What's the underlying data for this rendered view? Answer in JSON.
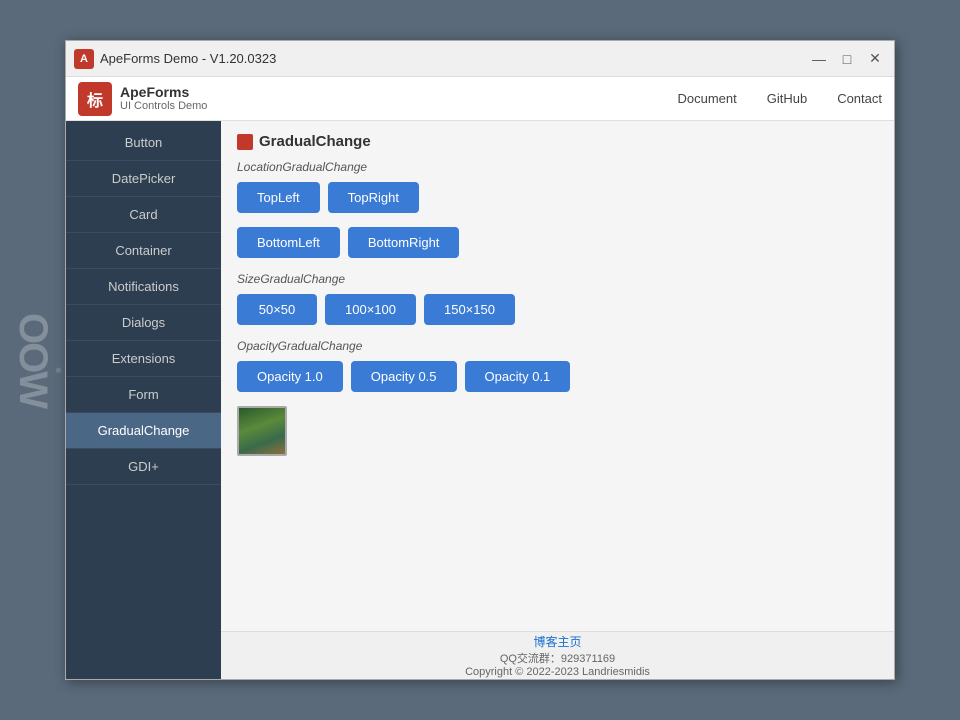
{
  "window": {
    "title": "ApeForms Demo - V1.20.0323",
    "controls": {
      "minimize": "—",
      "maximize": "□",
      "close": "✕"
    }
  },
  "header": {
    "logo_icon": "标",
    "logo_title": "ApeForms",
    "logo_subtitle": "UI Controls Demo",
    "nav": [
      {
        "id": "document",
        "label": "Document"
      },
      {
        "id": "github",
        "label": "GitHub"
      },
      {
        "id": "contact",
        "label": "Contact"
      }
    ]
  },
  "sidebar": {
    "items": [
      {
        "id": "button",
        "label": "Button",
        "active": false
      },
      {
        "id": "datepicker",
        "label": "DatePicker",
        "active": false
      },
      {
        "id": "card",
        "label": "Card",
        "active": false
      },
      {
        "id": "container",
        "label": "Container",
        "active": false
      },
      {
        "id": "notifications",
        "label": "Notifications",
        "active": false
      },
      {
        "id": "dialogs",
        "label": "Dialogs",
        "active": false
      },
      {
        "id": "extensions",
        "label": "Extensions",
        "active": false
      },
      {
        "id": "form",
        "label": "Form",
        "active": false
      },
      {
        "id": "gradualchange",
        "label": "GradualChange",
        "active": true
      },
      {
        "id": "gdiplus",
        "label": "GDI+",
        "active": false
      }
    ]
  },
  "content": {
    "section_icon_color": "#c0392b",
    "section_title": "GradualChange",
    "location_label": "LocationGradualChange",
    "location_buttons": [
      {
        "id": "topleft",
        "label": "TopLeft"
      },
      {
        "id": "topright",
        "label": "TopRight"
      },
      {
        "id": "bottomleft",
        "label": "BottomLeft"
      },
      {
        "id": "bottomright",
        "label": "BottomRight"
      }
    ],
    "size_label": "SizeGradualChange",
    "size_buttons": [
      {
        "id": "size50",
        "label": "50×50"
      },
      {
        "id": "size100",
        "label": "100×100"
      },
      {
        "id": "size150",
        "label": "150×150"
      }
    ],
    "opacity_label": "OpacityGradualChange",
    "opacity_buttons": [
      {
        "id": "opacity10",
        "label": "Opacity 1.0"
      },
      {
        "id": "opacity05",
        "label": "Opacity 0.5"
      },
      {
        "id": "opacity01",
        "label": "Opacity 0.1"
      }
    ]
  },
  "footer": {
    "link_text": "博客主页",
    "qq_text": "QQ交流群：929371169",
    "copyright_text": "Copyright © 2022-2023 Landriesmidis"
  }
}
